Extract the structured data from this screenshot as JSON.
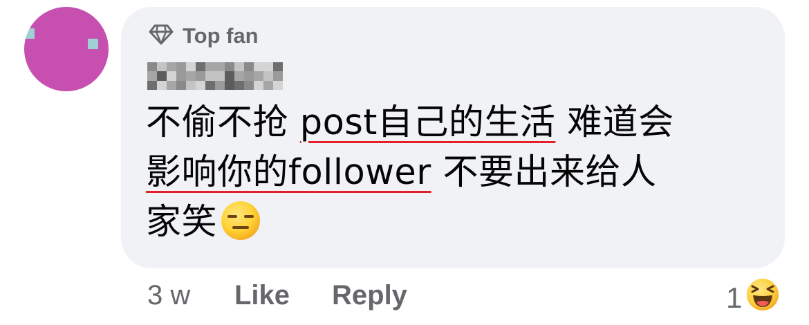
{
  "badge": {
    "label": "Top fan",
    "icon": "diamond-icon"
  },
  "comment": {
    "underlined_1": "post自己的生活",
    "underlined_2": "影响你的follower",
    "line1_start": "不偷不抢 ",
    "line1_end": " 难道会",
    "line2_end": " 不要出来给人",
    "line3": "家笑",
    "emoji": "expressionless-face-emoji"
  },
  "meta": {
    "time": "3 w",
    "like": "Like",
    "reply": "Reply"
  },
  "reactions": {
    "count": "1",
    "icon": "laughing-face-emoji"
  },
  "colors": {
    "bubble": "#f0f2f5",
    "meta_text": "#65676b",
    "underline": "#e4212b"
  }
}
